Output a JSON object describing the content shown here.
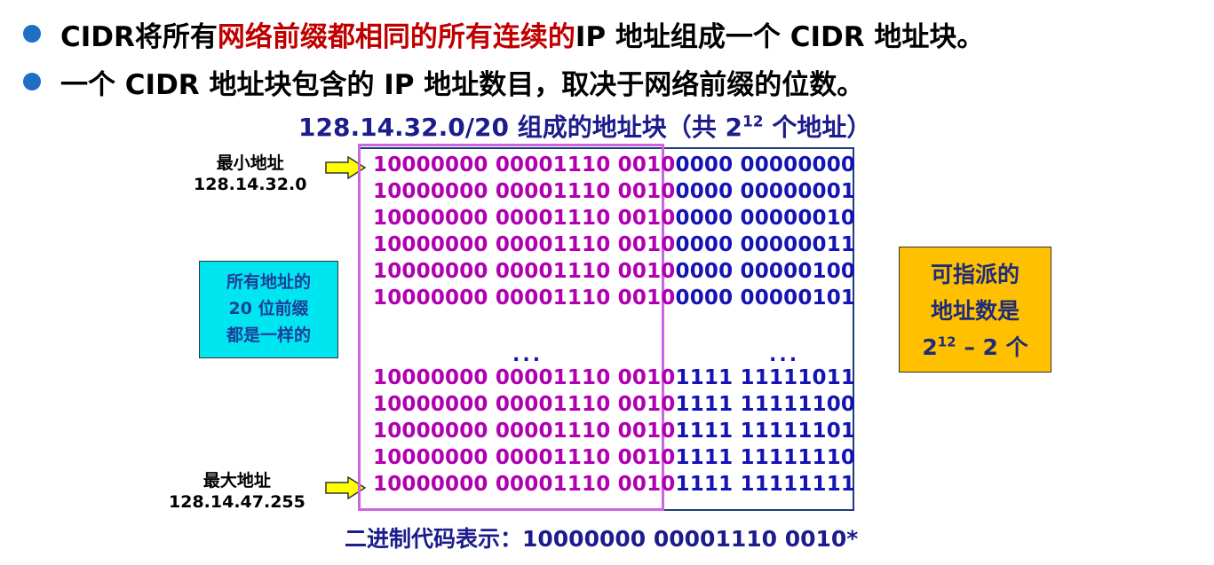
{
  "bullets": [
    {
      "before": "CIDR将所有",
      "highlight": "网络前缀都相同的所有连续的",
      "after": " IP 地址组成一个 CIDR 地址块。"
    },
    {
      "before": "一个 CIDR 地址块包含的 IP 地址数目，取决于网络前缀的位数。",
      "highlight": "",
      "after": ""
    }
  ],
  "subtitle": {
    "prefix": "128.14.32.0/20  组成的地址块（共 2",
    "exp": "12",
    "suffix": " 个地址）"
  },
  "min_label": {
    "title": "最小地址",
    "addr": "128.14.32.0"
  },
  "max_label": {
    "title": "最大地址",
    "addr": "128.14.47.255"
  },
  "rows_top": [
    {
      "prefix": "10000000 00001110 0010",
      "suffix": "0000 00000000"
    },
    {
      "prefix": "10000000 00001110 0010",
      "suffix": "0000 00000001"
    },
    {
      "prefix": "10000000 00001110 0010",
      "suffix": "0000 00000010"
    },
    {
      "prefix": "10000000 00001110 0010",
      "suffix": "0000 00000011"
    },
    {
      "prefix": "10000000 00001110 0010",
      "suffix": "0000 00000100"
    },
    {
      "prefix": "10000000 00001110 0010",
      "suffix": "0000 00000101"
    }
  ],
  "ellipsis": "...",
  "rows_bottom": [
    {
      "prefix": "10000000 00001110 0010",
      "suffix": "1111 11111011"
    },
    {
      "prefix": "10000000 00001110 0010",
      "suffix": "1111 11111100"
    },
    {
      "prefix": "10000000 00001110 0010",
      "suffix": "1111 11111101"
    },
    {
      "prefix": "10000000 00001110 0010",
      "suffix": "1111 11111110"
    },
    {
      "prefix": "10000000 00001110 0010",
      "suffix": "1111 11111111"
    }
  ],
  "cyan_box": [
    "所有地址的",
    "20 位前缀",
    "都是一样的"
  ],
  "gold_box": {
    "line1": "可指派的",
    "line2": "地址数是",
    "base": "2",
    "exp": "12",
    "tail": " – 2 个"
  },
  "footer": "二进制代码表示：10000000 00001110 0010*",
  "colors": {
    "bullet": "#1f6fc5",
    "highlight": "#c00000",
    "prefix_bits": "#b000b0",
    "suffix_bits": "#1414b4",
    "cyan": "#00e6f0",
    "gold": "#ffc000",
    "arrow": "#ffff00"
  }
}
